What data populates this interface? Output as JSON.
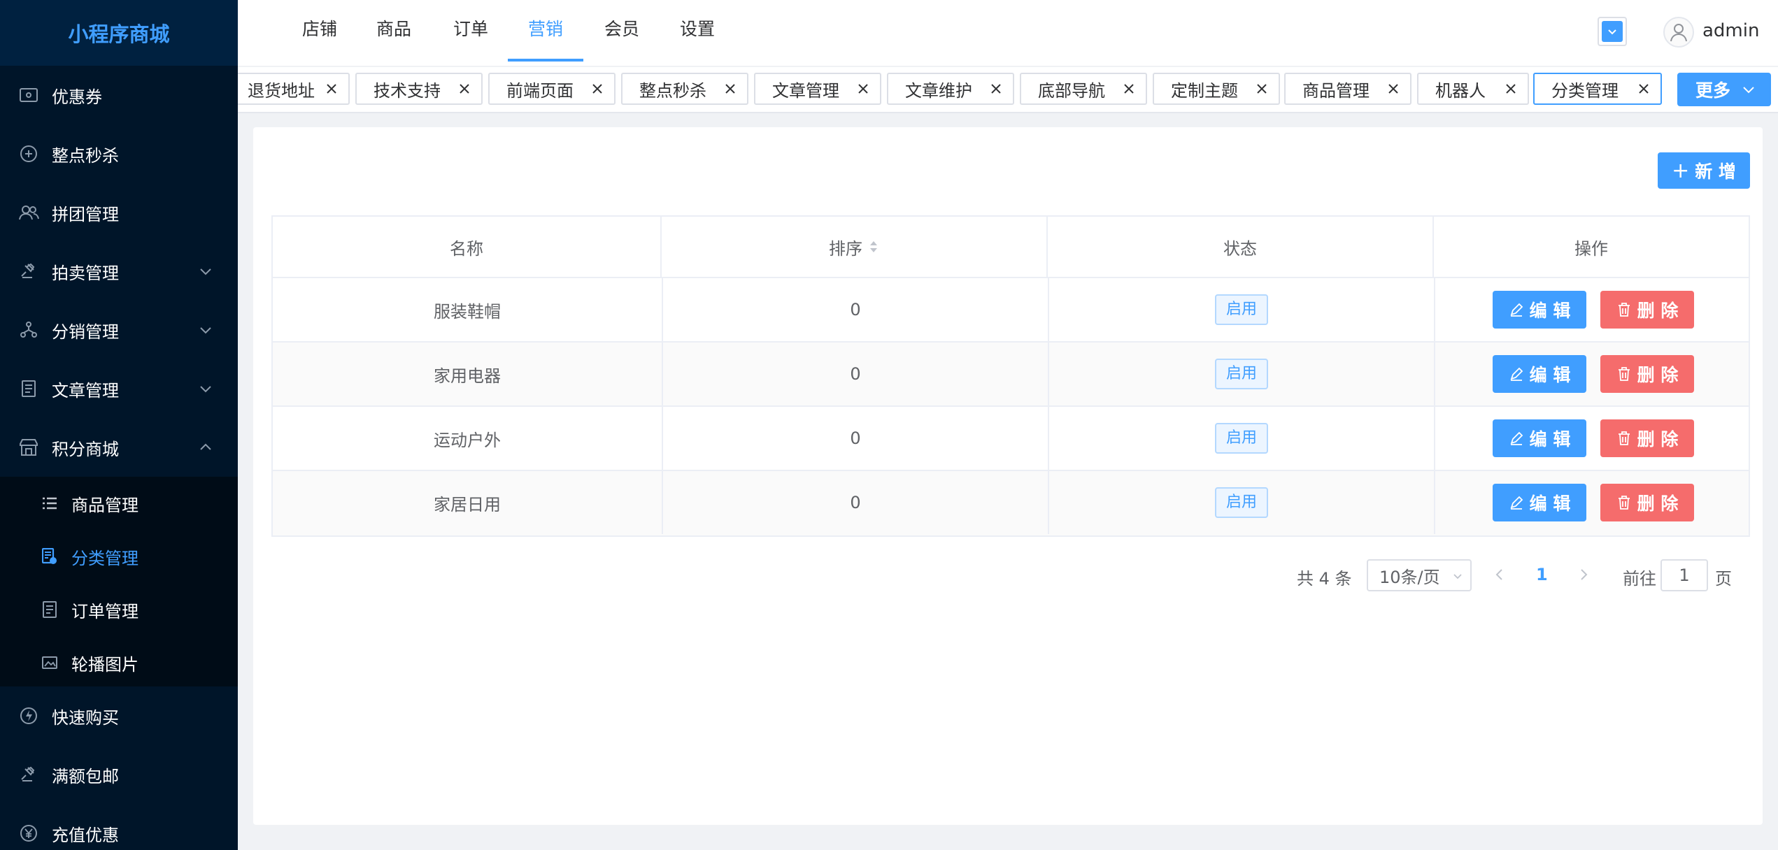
{
  "brand": "小程序商城",
  "sidebar": {
    "items": [
      {
        "label": "优惠券",
        "icon": "coupon-icon"
      },
      {
        "label": "整点秒杀",
        "icon": "flash-sale-icon"
      },
      {
        "label": "拼团管理",
        "icon": "group-buy-icon"
      },
      {
        "label": "拍卖管理",
        "icon": "auction-icon"
      },
      {
        "label": "分销管理",
        "icon": "distribution-icon"
      },
      {
        "label": "文章管理",
        "icon": "article-icon"
      },
      {
        "label": "积分商城",
        "icon": "points-mall-icon"
      },
      {
        "label": "快速购买",
        "icon": "quick-buy-icon"
      },
      {
        "label": "满额包邮",
        "icon": "free-shipping-icon"
      },
      {
        "label": "充值优惠",
        "icon": "recharge-icon"
      }
    ],
    "submenu": [
      {
        "label": "商品管理",
        "icon": "list-icon"
      },
      {
        "label": "分类管理",
        "icon": "category-icon"
      },
      {
        "label": "订单管理",
        "icon": "order-icon"
      },
      {
        "label": "轮播图片",
        "icon": "image-icon"
      }
    ]
  },
  "header": {
    "tabs": [
      "店铺",
      "商品",
      "订单",
      "营销",
      "会员",
      "设置"
    ],
    "active_tab": "营销",
    "username": "admin"
  },
  "tags": [
    "退货地址",
    "技术支持",
    "前端页面",
    "整点秒杀",
    "文章管理",
    "文章维护",
    "底部导航",
    "定制主题",
    "商品管理",
    "机器人",
    "分类管理"
  ],
  "active_tag": "分类管理",
  "more_label": "更多",
  "toolbar": {
    "add_label": "新 增"
  },
  "table": {
    "headers": [
      "名称",
      "排序",
      "状态",
      "操作"
    ],
    "rows": [
      {
        "name": "服装鞋帽",
        "sort": "0",
        "status": "启用"
      },
      {
        "name": "家用电器",
        "sort": "0",
        "status": "启用"
      },
      {
        "name": "运动户外",
        "sort": "0",
        "status": "启用"
      },
      {
        "name": "家居日用",
        "sort": "0",
        "status": "启用"
      }
    ],
    "edit_label": "编 辑",
    "delete_label": "删 除"
  },
  "pagination": {
    "total_text": "共 4 条",
    "page_size": "10条/页",
    "current_page": "1",
    "goto_prefix": "前往",
    "goto_value": "1",
    "goto_suffix": "页"
  },
  "colors": {
    "accent": "#409eff",
    "danger": "#f56c6c",
    "sidebar": "#001529"
  }
}
